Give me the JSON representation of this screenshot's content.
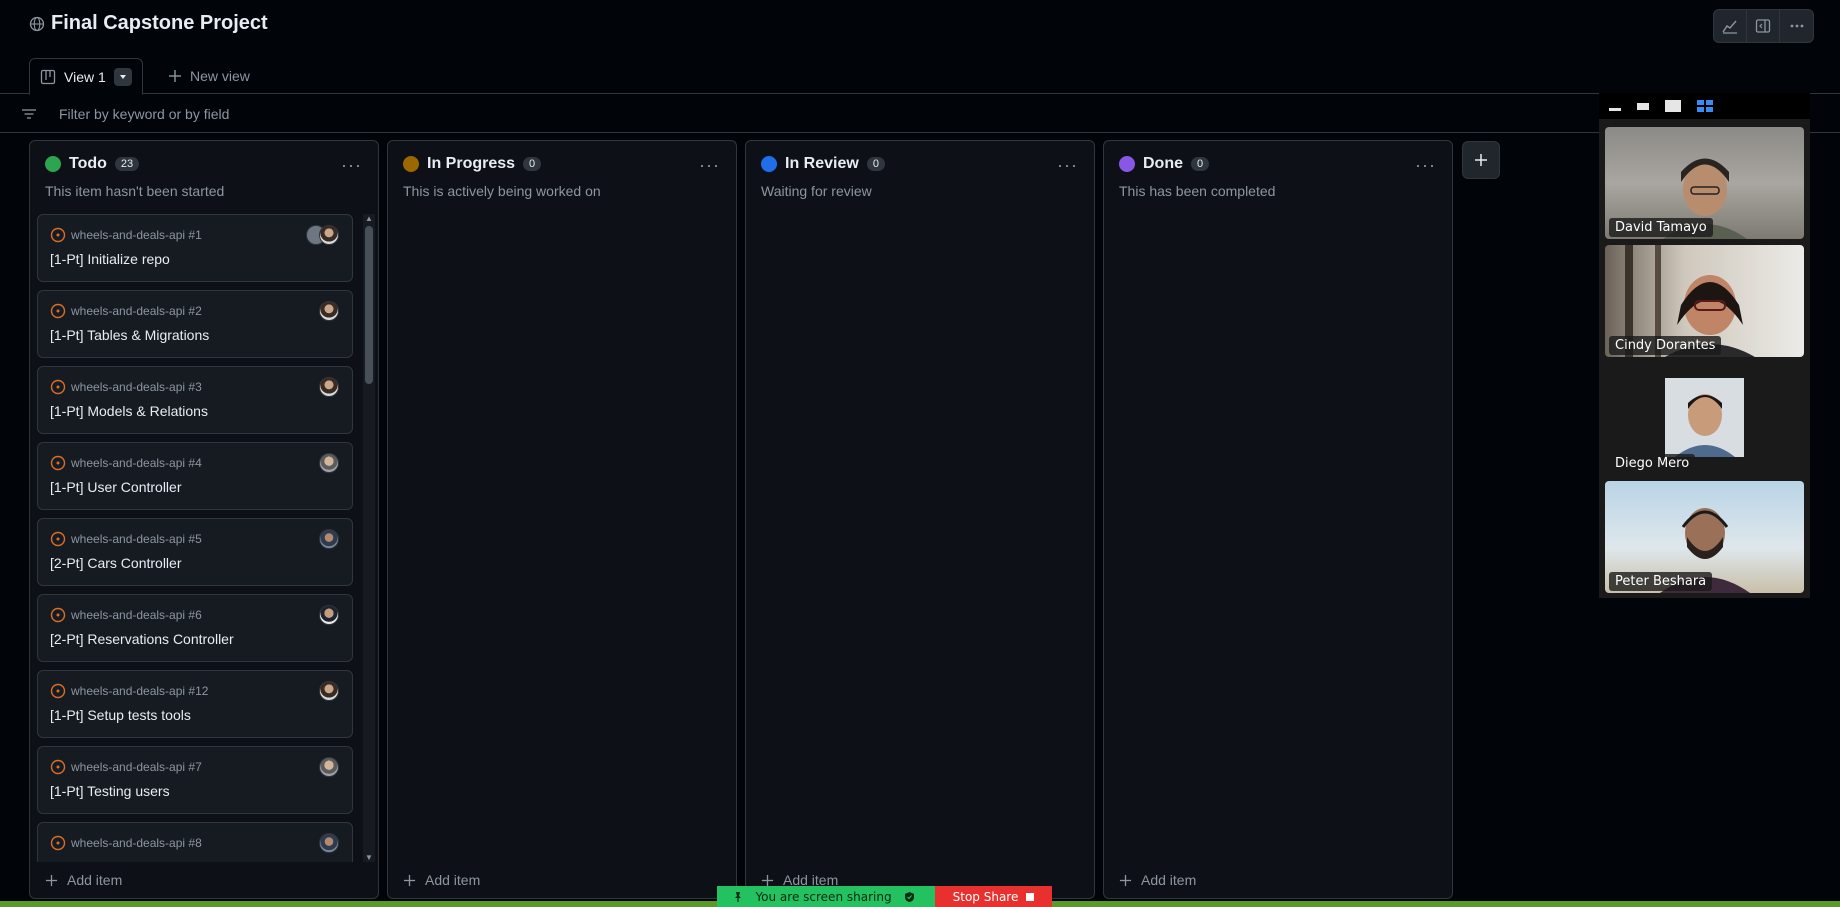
{
  "project": {
    "title": "Final Capstone Project"
  },
  "toolbar": {
    "icons": [
      "graph-icon",
      "sidebar-icon",
      "kebab-icon"
    ]
  },
  "tabs": {
    "active_label": "View 1",
    "new_view_label": "New view"
  },
  "filter": {
    "placeholder": "Filter by keyword or by field"
  },
  "columns": [
    {
      "name": "Todo",
      "count": "23",
      "description": "This item hasn't been started",
      "color": "#2da44e",
      "add_label": "Add item"
    },
    {
      "name": "In Progress",
      "count": "0",
      "description": "This is actively being worked on",
      "color": "#9a6700",
      "add_label": "Add item"
    },
    {
      "name": "In Review",
      "count": "0",
      "description": "Waiting for review",
      "color": "#1f6feb",
      "add_label": "Add item"
    },
    {
      "name": "Done",
      "count": "0",
      "description": "This has been completed",
      "color": "#8957e5",
      "add_label": "Add item"
    }
  ],
  "cards": [
    {
      "repo": "wheels-and-deals-api #1",
      "title": "[1-Pt] Initialize repo"
    },
    {
      "repo": "wheels-and-deals-api #2",
      "title": "[1-Pt] Tables & Migrations"
    },
    {
      "repo": "wheels-and-deals-api #3",
      "title": "[1-Pt] Models & Relations"
    },
    {
      "repo": "wheels-and-deals-api #4",
      "title": "[1-Pt] User Controller"
    },
    {
      "repo": "wheels-and-deals-api #5",
      "title": "[2-Pt] Cars Controller"
    },
    {
      "repo": "wheels-and-deals-api #6",
      "title": "[2-Pt] Reservations Controller"
    },
    {
      "repo": "wheels-and-deals-api #12",
      "title": "[1-Pt] Setup tests tools"
    },
    {
      "repo": "wheels-and-deals-api #7",
      "title": "[1-Pt] Testing users"
    },
    {
      "repo": "wheels-and-deals-api #8",
      "title": ""
    }
  ],
  "video": {
    "participants": [
      {
        "name": "David Tamayo"
      },
      {
        "name": "Cindy Dorantes"
      },
      {
        "name": "Diego Mero"
      },
      {
        "name": "Peter Beshara"
      }
    ]
  },
  "share": {
    "status_label": "You are screen sharing",
    "stop_label": "Stop Share"
  },
  "colors": {
    "issue_open": "#db6d28",
    "accent": "#1f6feb"
  }
}
